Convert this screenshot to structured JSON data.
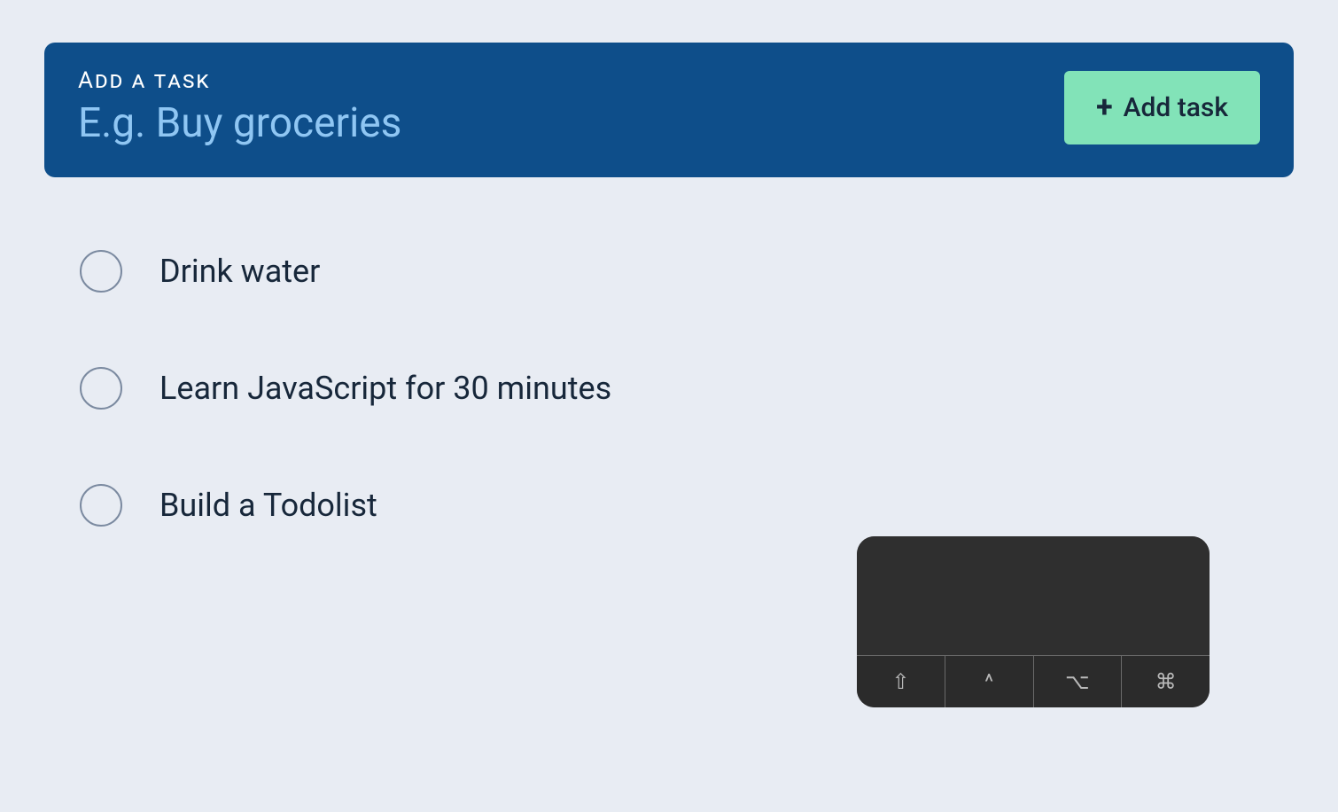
{
  "addTask": {
    "label": "Add a task",
    "placeholder": "E.g. Buy groceries",
    "value": "",
    "buttonLabel": "Add task",
    "plusGlyph": "+"
  },
  "tasks": [
    {
      "text": "Drink water"
    },
    {
      "text": "Learn JavaScript for 30 minutes"
    },
    {
      "text": "Build a Todolist"
    }
  ],
  "keyboard": {
    "keys": [
      {
        "glyph": "⇧",
        "name": "shift"
      },
      {
        "glyph": "^",
        "name": "control"
      },
      {
        "glyph": "⌥",
        "name": "option"
      },
      {
        "glyph": "⌘",
        "name": "command"
      }
    ]
  }
}
